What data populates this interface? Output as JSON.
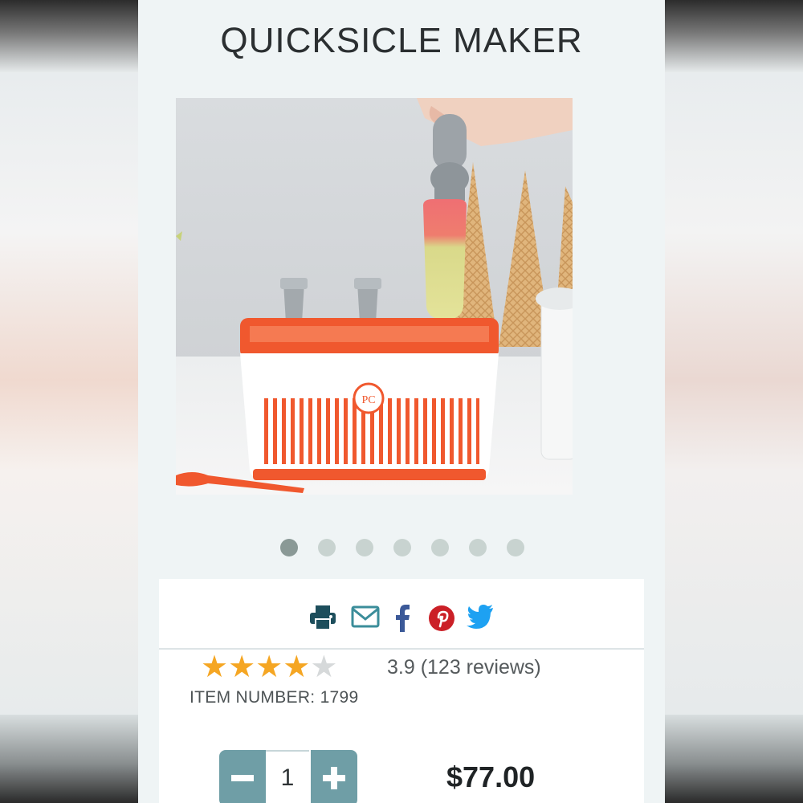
{
  "product": {
    "title": "QUICKSICLE MAKER",
    "image_alt": "Quicksicle maker with ice pop being pulled out",
    "logo_text": "PC"
  },
  "carousel": {
    "count": 7,
    "active_index": 0
  },
  "share": {
    "icons": [
      "print-icon",
      "email-icon",
      "facebook-icon",
      "pinterest-icon",
      "twitter-icon"
    ]
  },
  "rating": {
    "value": 3.9,
    "text": "3.9 (123 reviews)",
    "stars_filled": 4,
    "stars_total": 5
  },
  "item": {
    "number_text": "ITEM NUMBER: 1799"
  },
  "purchase": {
    "minus_symbol": "−",
    "plus_symbol": "+",
    "quantity": "1",
    "price": "$77.00"
  },
  "colors": {
    "accent": "#6f9ea6",
    "star": "#f5a623",
    "brand_red": "#f0582e",
    "print_icon": "#1d4e5c",
    "email_icon": "#3b8d9a",
    "facebook": "#3b5998",
    "pinterest": "#cb2027",
    "twitter": "#1da1f2"
  }
}
